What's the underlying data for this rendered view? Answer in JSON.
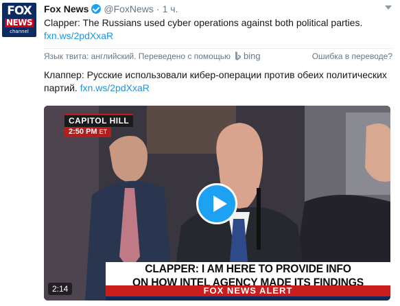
{
  "avatar": {
    "line1": "FOX",
    "line2": "NEWS",
    "line3": "channel"
  },
  "tweet": {
    "name": "Fox News",
    "handle": "@FoxNews",
    "separator": "·",
    "time": "1 ч.",
    "text": "Clapper: The Russians used cyber operations against both political parties.",
    "link": "fxn.ws/2pdXxaR",
    "translated_text": "Клаппер: Русские использовали кибер-операции против обеих политических партий.",
    "translated_link": "fxn.ws/2pdXxaR"
  },
  "translation": {
    "label": "Язык твита: английский. Переведено с помощью",
    "service": "bing",
    "report": "Ошибка в переводе?"
  },
  "video": {
    "bug_title": "CAPITOL HILL",
    "bug_time": "2:50 PM",
    "bug_zone": "ET",
    "headline_line1": "CLAPPER: I AM HERE TO PROVIDE INFO",
    "headline_line2": "ON HOW INTEL AGENCY MADE ITS FINDINGS",
    "alert": "FOX NEWS ALERT",
    "duration": "2:14"
  },
  "colors": {
    "link": "#1b95e0",
    "verified": "#1da1f2",
    "play_button": "#1da1f2",
    "alert_red": "#c81e1e",
    "secondary_text": "#657786"
  }
}
